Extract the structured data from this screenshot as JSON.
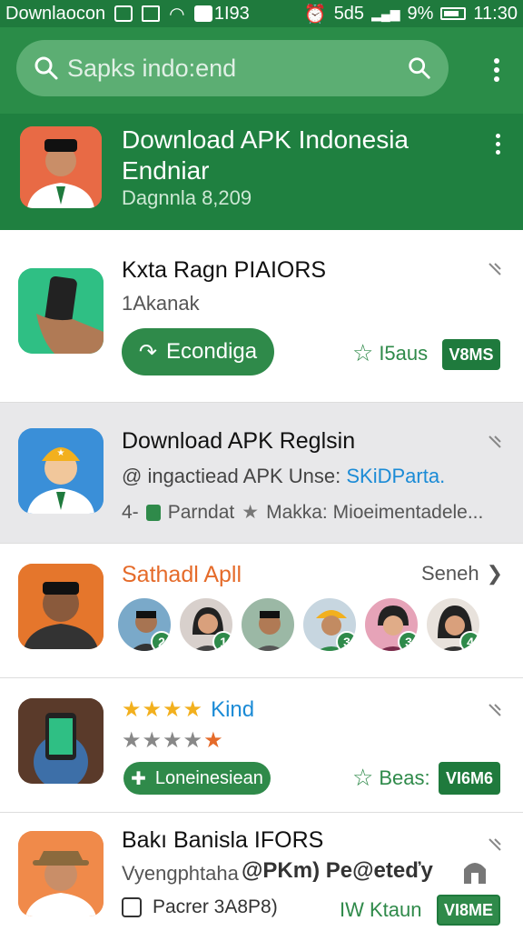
{
  "status_bar": {
    "left_text": "Downlaocon",
    "center_time": "1I93",
    "signal_text": "5d5",
    "battery_percent": "9%",
    "clock": "11:30"
  },
  "search": {
    "placeholder": "Sapks indo:end"
  },
  "hero": {
    "title": "Download APK Indonesia Endniar",
    "subtitle": "Dagnnla 8,209"
  },
  "cards": [
    {
      "title": "Kxta Ragn PIAIORS",
      "subtitle": "1Akanak",
      "button_label": "Econdiga",
      "rating_label": "I5aus",
      "tag": "V8MS"
    },
    {
      "title": "Download APK Reglsin",
      "desc_prefix": "@ ingactiead APK Unse: ",
      "desc_link": "SKiDParta.",
      "meta_left": "4-",
      "meta_category": "Parndat",
      "meta_rest": "Makka: Mioeimentadele..."
    },
    {
      "title": "Sathadl Apll",
      "see_more": "Seneh",
      "avatar_numbers": [
        "2",
        "1",
        "",
        "3",
        "3",
        "4"
      ]
    },
    {
      "rating_text": "Kind",
      "button_label": "Loneinesiean",
      "rating_label": "Beas:",
      "tag": "VI6M6"
    },
    {
      "title": "Bakı Banisla IFORS",
      "subtitle": "Vyengphtaha",
      "watermark": "@PKm) Pe@eteďy",
      "meta_label": "Pacrer 3A8P8)",
      "rating_label": "IW Ktаun",
      "tag": "VI8ME"
    }
  ],
  "colors": {
    "primary_green": "#2a8c48",
    "dark_green": "#1f7a3d",
    "star_gold": "#f2b01e",
    "accent_orange": "#e56b2a",
    "link_blue": "#1b8bd6"
  }
}
